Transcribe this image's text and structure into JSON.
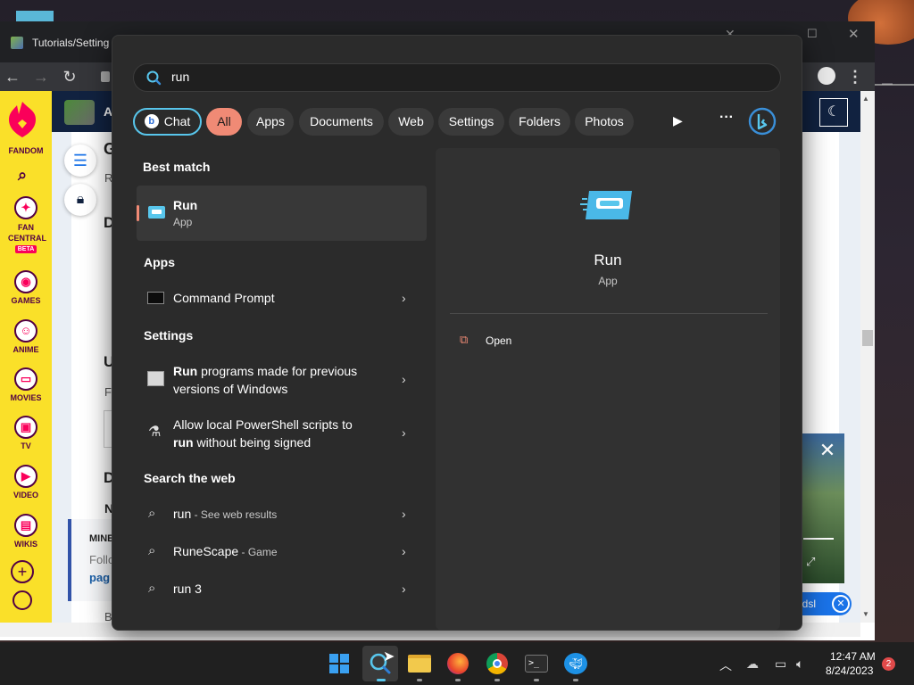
{
  "browser": {
    "tab_title": "Tutorials/Setting",
    "profile_icon": "person-icon",
    "menu_icon": "kebab-icon"
  },
  "fandom": {
    "brand": "FANDOM",
    "items": [
      {
        "label": "FAN CENTRAL",
        "badge": "BETA"
      },
      {
        "label": "GAMES"
      },
      {
        "label": "ANIME"
      },
      {
        "label": "MOVIES"
      },
      {
        "label": "TV"
      },
      {
        "label": "VIDEO"
      },
      {
        "label": "WIKIS"
      }
    ]
  },
  "page": {
    "letters": [
      "G",
      "R",
      "D",
      "U",
      "F",
      "D",
      "N",
      "B"
    ],
    "follow_title": "MINE",
    "follow_text": "Follo",
    "follow_link": "pag",
    "friends_label": "ndsl"
  },
  "start_menu": {
    "search_value": "run",
    "chips": [
      "Chat",
      "All",
      "Apps",
      "Documents",
      "Web",
      "Settings",
      "Folders",
      "Photos"
    ],
    "best_match": {
      "heading": "Best match",
      "title": "Run",
      "subtitle": "App"
    },
    "apps": {
      "heading": "Apps",
      "items": [
        {
          "title": "Command Prompt"
        }
      ]
    },
    "settings": {
      "heading": "Settings",
      "items": [
        {
          "bold": "Run",
          "rest_line1": " programs made for previous",
          "line2": "versions of Windows"
        },
        {
          "line1": "Allow local PowerShell scripts to",
          "bold": "run",
          "rest_line2": " without being signed"
        }
      ]
    },
    "web": {
      "heading": "Search the web",
      "items": [
        {
          "main": "run",
          "suffix": " - See web results"
        },
        {
          "main": "RuneScape",
          "suffix": " - Game"
        },
        {
          "main": "run 3",
          "suffix": ""
        }
      ]
    },
    "preview": {
      "title": "Run",
      "subtitle": "App",
      "action": "Open"
    }
  },
  "taskbar": {
    "time": "12:47 AM",
    "date": "8/24/2023",
    "notification_count": "2",
    "apps": [
      "windows-start-icon",
      "search-icon",
      "file-explorer-icon",
      "firefox-icon",
      "chrome-icon",
      "terminal-icon",
      "docker-icon"
    ]
  },
  "colors": {
    "accent": "#f08a75",
    "chat_border": "#58c6ec",
    "fandom_yellow": "#fae029",
    "fandom_pink": "#fa005a"
  }
}
